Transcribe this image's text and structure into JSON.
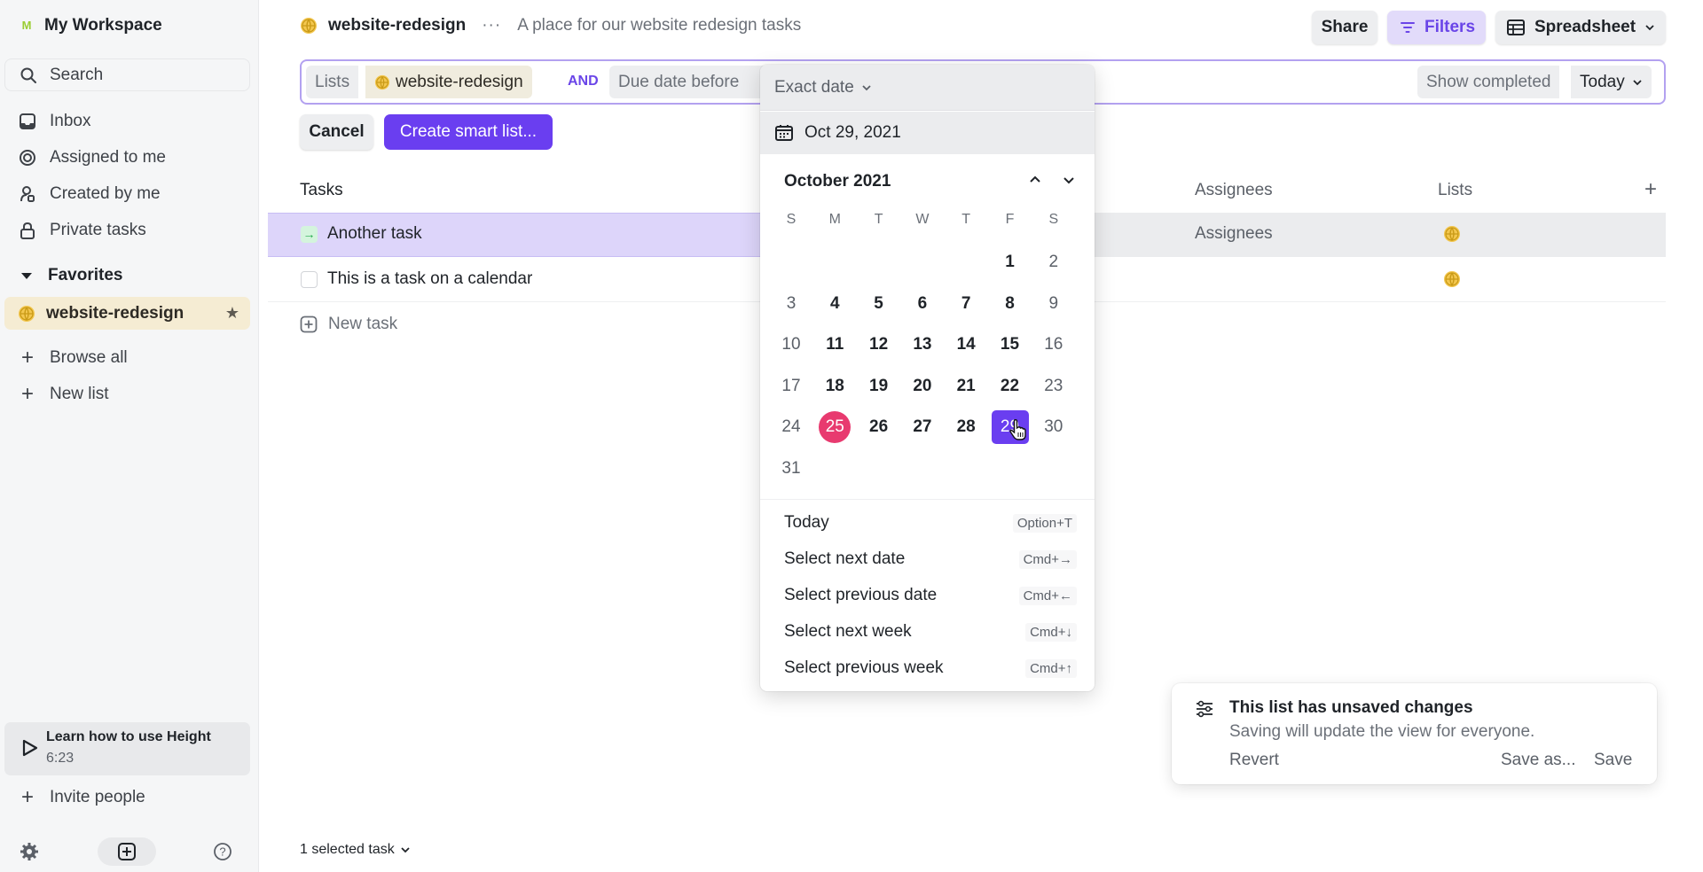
{
  "sidebar": {
    "workspace_initial": "M",
    "workspace_name": "My Workspace",
    "search_label": "Search",
    "nav": [
      {
        "label": "Inbox",
        "icon": "inbox-icon"
      },
      {
        "label": "Assigned to me",
        "icon": "target-icon"
      },
      {
        "label": "Created by me",
        "icon": "user-created-icon"
      },
      {
        "label": "Private tasks",
        "icon": "lock-icon"
      }
    ],
    "favorites_label": "Favorites",
    "favorite_item": "website-redesign",
    "browse_all": "Browse all",
    "new_list": "New list",
    "learn_title": "Learn how to use Height",
    "learn_duration": "6:23",
    "invite": "Invite people"
  },
  "header": {
    "list_name": "website-redesign",
    "more": "···",
    "description": "A place for our website redesign tasks",
    "share": "Share",
    "filters": "Filters",
    "view": "Spreadsheet"
  },
  "filterbar": {
    "lists_label": "Lists",
    "list_value": "website-redesign",
    "and": "AND",
    "due_label": "Due date before",
    "show_completed": "Show completed",
    "today": "Today"
  },
  "actions": {
    "cancel": "Cancel",
    "create": "Create smart list..."
  },
  "table": {
    "columns": {
      "tasks": "Tasks",
      "assignees": "Assignees",
      "lists": "Lists",
      "add": "+"
    },
    "rows": [
      {
        "name": "Another task",
        "assignees": "Assignees",
        "status": "in-progress"
      },
      {
        "name": "This is a task on a calendar",
        "assignees": "",
        "status": "todo"
      }
    ],
    "new_task": "New task"
  },
  "datepicker": {
    "mode": "Exact date",
    "input_value": "Oct 29, 2021",
    "month_label": "October 2021",
    "weekdays": [
      "S",
      "M",
      "T",
      "W",
      "T",
      "F",
      "S"
    ],
    "first_weekday_index": 5,
    "days_in_month": 31,
    "today_day": 25,
    "selected_day": 29,
    "shortcuts": [
      {
        "label": "Today",
        "key": "Option+T"
      },
      {
        "label": "Select next date",
        "key": "Cmd+→"
      },
      {
        "label": "Select previous date",
        "key": "Cmd+←"
      },
      {
        "label": "Select next week",
        "key": "Cmd+↓"
      },
      {
        "label": "Select previous week",
        "key": "Cmd+↑"
      }
    ]
  },
  "toast": {
    "title": "This list has unsaved changes",
    "message": "Saving will update the view for everyone.",
    "revert": "Revert",
    "save_as": "Save as...",
    "save": "Save"
  },
  "footer": {
    "selected": "1 selected task"
  },
  "colors": {
    "accent": "#6a3ef0",
    "today": "#e83a6f",
    "favorite_bg": "#f5ecd3"
  }
}
